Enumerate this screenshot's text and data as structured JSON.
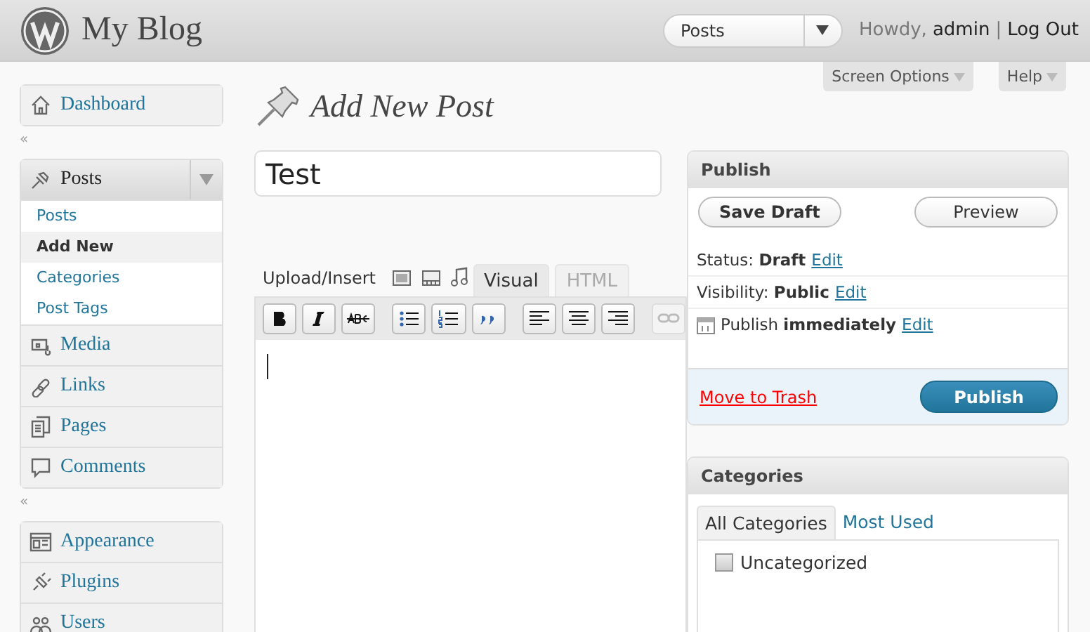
{
  "header": {
    "site_title": "My Blog",
    "favorites": {
      "value": "Posts"
    },
    "greeting": "Howdy,",
    "user": "admin",
    "separator": "|",
    "logout": "Log Out"
  },
  "screen_tabs": [
    "Screen Options",
    "Help"
  ],
  "menu": [
    {
      "label": "Dashboard",
      "expanded": false
    },
    {
      "label": "Posts",
      "expanded": true,
      "children": [
        {
          "label": "Posts",
          "selected": false
        },
        {
          "label": "Add New",
          "selected": true
        },
        {
          "label": "Categories",
          "selected": false
        },
        {
          "label": "Post Tags",
          "selected": false
        }
      ]
    },
    {
      "label": "Media",
      "expanded": false
    },
    {
      "label": "Links",
      "expanded": false
    },
    {
      "label": "Pages",
      "expanded": false
    },
    {
      "label": "Comments",
      "expanded": false
    },
    {
      "label": "Appearance",
      "expanded": false
    },
    {
      "label": "Plugins",
      "expanded": false
    },
    {
      "label": "Users",
      "expanded": false
    }
  ],
  "collapse_marks": [
    "«",
    "«"
  ],
  "page_title": "Add New Post",
  "post_title": {
    "value": "Test"
  },
  "upload_label": "Upload/Insert",
  "editor_tabs": [
    {
      "label": "Visual",
      "selected": true
    },
    {
      "label": "HTML",
      "selected": false
    }
  ],
  "toolbar": [
    {
      "kind": "bold",
      "disabled": false
    },
    {
      "kind": "italic",
      "disabled": false
    },
    {
      "kind": "strike",
      "disabled": false
    },
    {
      "kind": "bullets",
      "disabled": false
    },
    {
      "kind": "numbers",
      "disabled": false
    },
    {
      "kind": "quote",
      "disabled": false
    },
    {
      "kind": "left",
      "disabled": false
    },
    {
      "kind": "center",
      "disabled": false
    },
    {
      "kind": "right",
      "disabled": false
    },
    {
      "kind": "link",
      "disabled": true
    }
  ],
  "publish": {
    "title": "Publish",
    "save_draft": "Save Draft",
    "preview": "Preview",
    "rows": [
      {
        "kind": "plain",
        "text": "Status: **Draft**",
        "edit": "Edit"
      },
      {
        "kind": "plain",
        "text": "Visibility: **Public**",
        "edit": "Edit"
      },
      {
        "kind": "calendar",
        "text": "Publish **immediately**",
        "edit": "Edit"
      }
    ],
    "trash": "Move to Trash",
    "publish_button": "Publish"
  },
  "categories": {
    "title": "Categories",
    "tabs": [
      {
        "label": "All Categories",
        "selected": true
      },
      {
        "label": "Most Used",
        "selected": false
      }
    ],
    "items": [
      {
        "label": "Uncategorized",
        "checked": false
      }
    ]
  }
}
